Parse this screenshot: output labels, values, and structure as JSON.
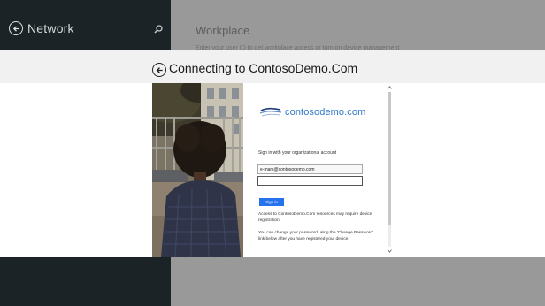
{
  "background": {
    "nav_title": "Network",
    "page_title": "Workplace",
    "description": "Enter your user ID to get workplace access or turn on device management"
  },
  "dialog": {
    "title": "Connecting to ContosoDemo.Com"
  },
  "form": {
    "logo_text": "contosodemo.com",
    "heading": "Sign in with your organizational account",
    "email_value": "e-mars@contosodemo.com",
    "password_value": "",
    "signin_label": "Sign in",
    "info_1": "Access to ContosoDemo.Com resources may require device registration.",
    "info_2": "You can change your password using the 'Change Password' link below after you have registered your device."
  },
  "colors": {
    "accent": "#2672ec",
    "logo": "#2e78c7",
    "left_pane": "#1c2326",
    "band": "#f1f1f1"
  },
  "icons": [
    "back-arrow-icon",
    "search-icon",
    "scroll-up-icon",
    "scroll-down-icon",
    "contoso-logo-icon"
  ]
}
